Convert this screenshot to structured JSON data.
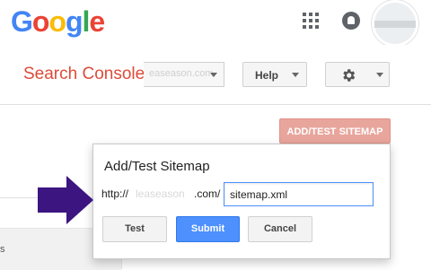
{
  "google": {
    "logo_letters": [
      "G",
      "o",
      "o",
      "g",
      "l",
      "e"
    ],
    "logo_colors": [
      "#4285f4",
      "#ea4335",
      "#fbbc05",
      "#4285f4",
      "#34a853",
      "#ea4335"
    ]
  },
  "header": {
    "title": "Search Console",
    "site_select": "easeason.com",
    "help_label": "Help"
  },
  "page": {
    "add_button_label": "ADD/TEST SITEMAP",
    "left_panel_text": "s"
  },
  "dialog": {
    "title": "Add/Test Sitemap",
    "url_prefix": "http://",
    "url_domain": "leaseason",
    "url_suffix": ".com/",
    "input_value": "sitemap.xml",
    "test_label": "Test",
    "submit_label": "Submit",
    "cancel_label": "Cancel"
  },
  "colors": {
    "accent": "#dd4b39",
    "submit": "#4d90fe",
    "arrow": "#3c1580",
    "add_button": "#e8a59c"
  },
  "icons": [
    "apps-grid-icon",
    "notifications-bell-icon",
    "gear-icon",
    "chevron-down-icon",
    "arrow-right-icon"
  ]
}
